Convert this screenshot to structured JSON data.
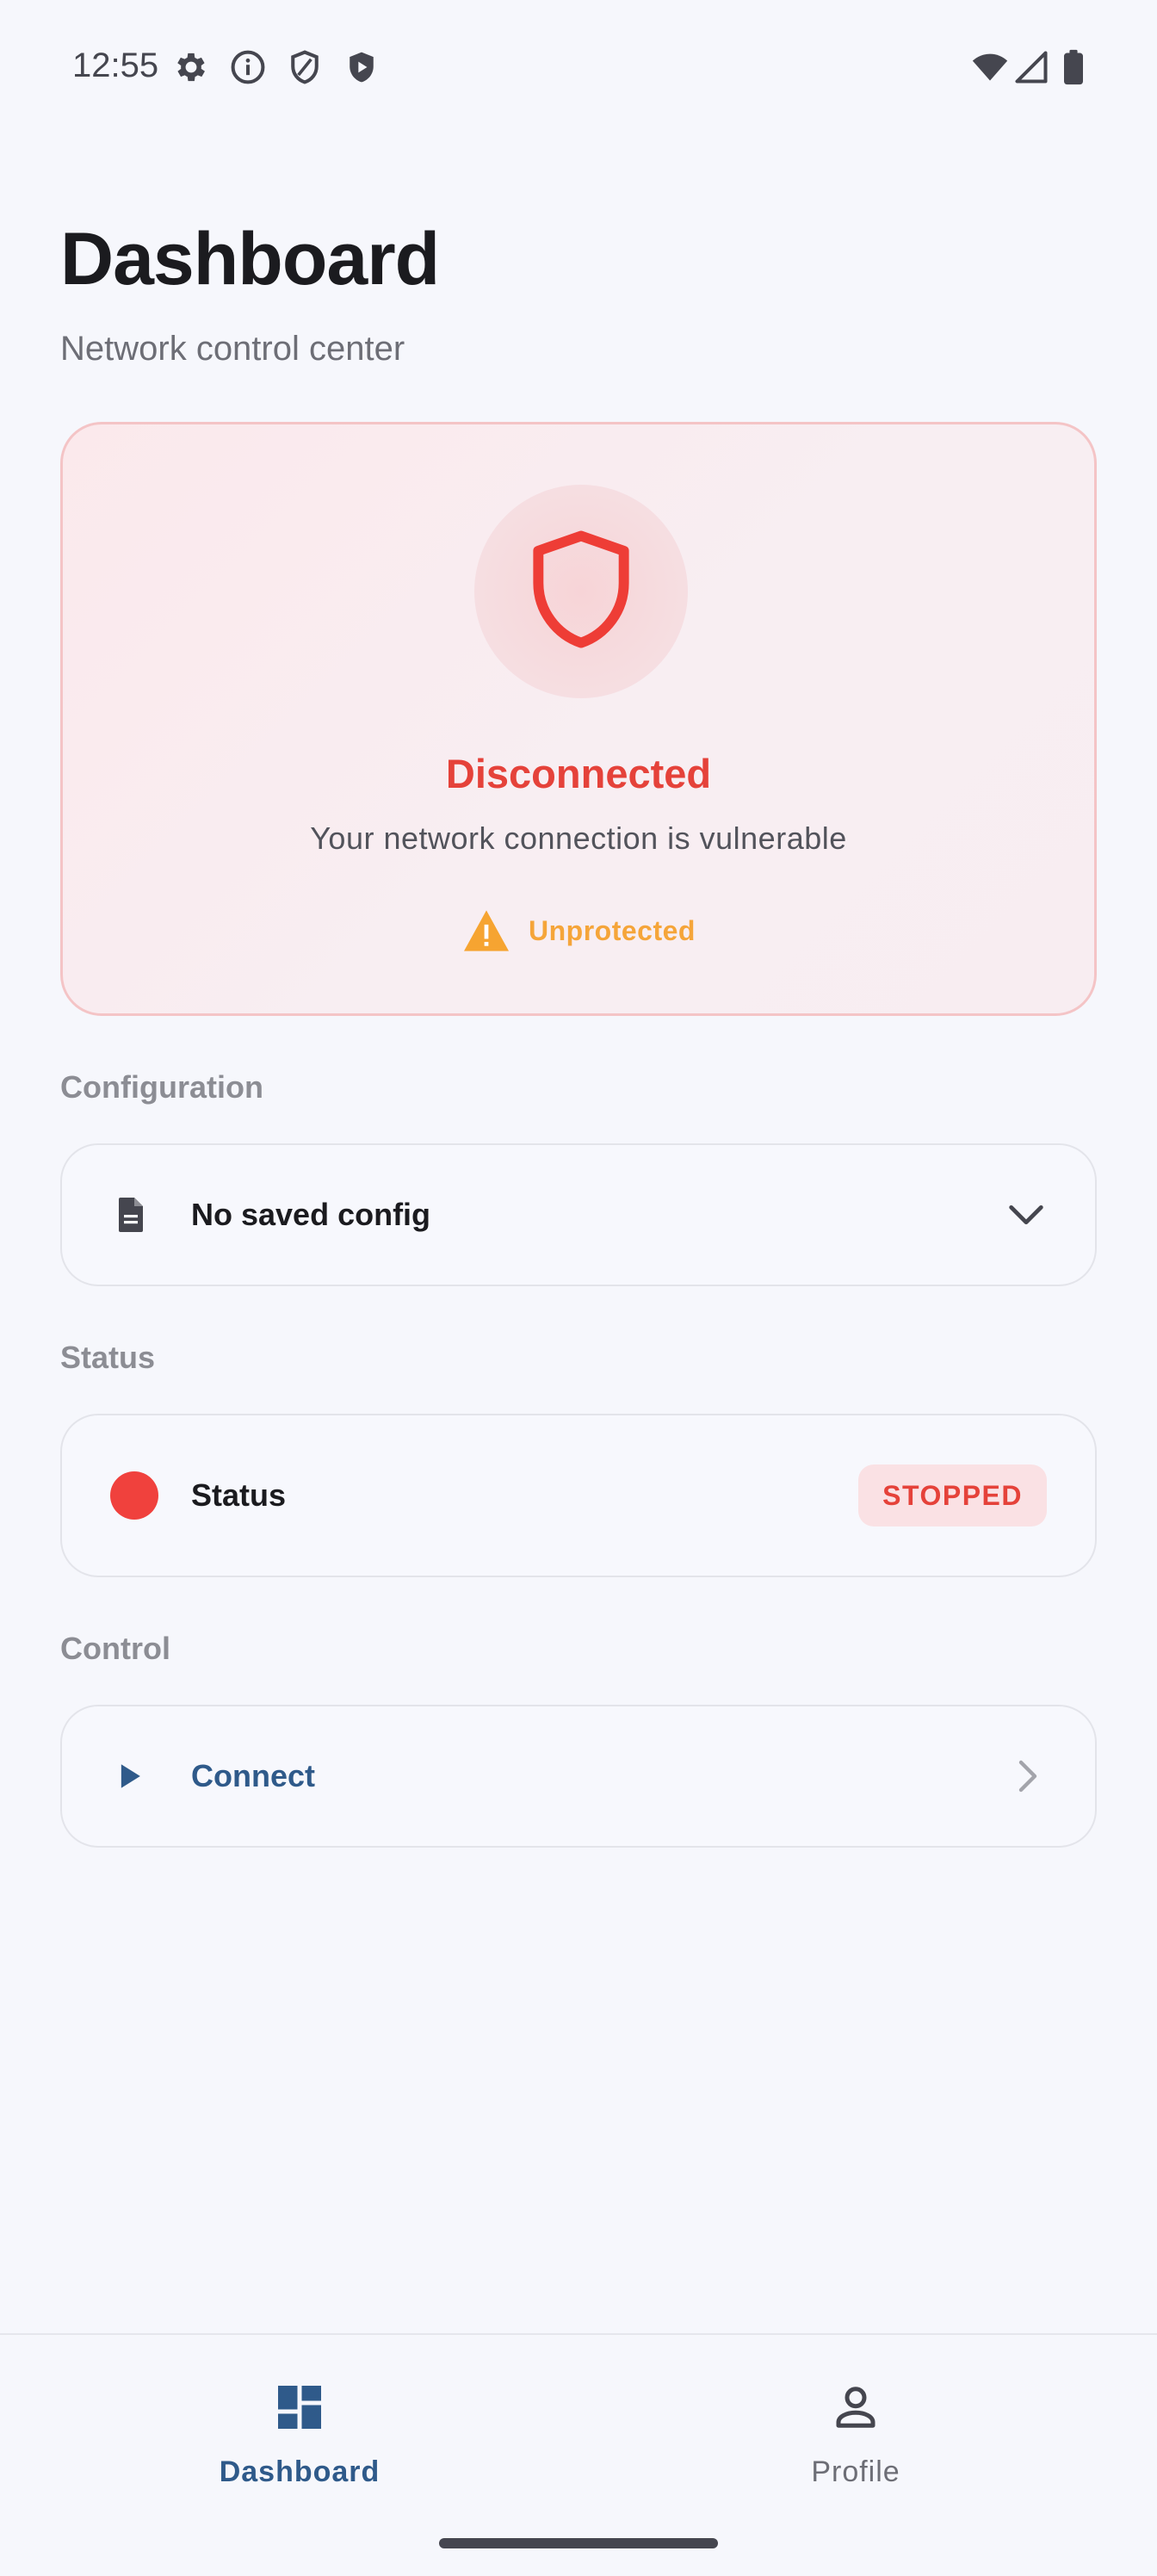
{
  "status_bar": {
    "time": "12:55",
    "left_icons": [
      "gear-icon",
      "info-icon",
      "shield-outline-icon",
      "shield-play-icon"
    ],
    "right_icons": [
      "wifi-icon",
      "signal-icon",
      "battery-icon"
    ]
  },
  "header": {
    "title": "Dashboard",
    "subtitle": "Network control center"
  },
  "connection_card": {
    "title": "Disconnected",
    "description": "Your network connection is vulnerable",
    "warning_label": "Unprotected",
    "icon": "shield-icon",
    "accent": "#e5423a",
    "warning_color": "#f5a53a"
  },
  "sections": {
    "configuration": "Configuration",
    "status": "Status",
    "control": "Control"
  },
  "config_row": {
    "icon": "document-icon",
    "label": "No saved config",
    "trailing_icon": "chevron-down-icon"
  },
  "status_row": {
    "label": "Status",
    "badge": "STOPPED",
    "dot_color": "#f0413d"
  },
  "control_row": {
    "icon": "play-icon",
    "label": "Connect",
    "trailing_icon": "chevron-right-icon",
    "color": "#2f5a8a"
  },
  "bottom_nav": {
    "items": [
      {
        "label": "Dashboard",
        "icon": "dashboard-icon",
        "active": true
      },
      {
        "label": "Profile",
        "icon": "person-icon",
        "active": false
      }
    ]
  }
}
